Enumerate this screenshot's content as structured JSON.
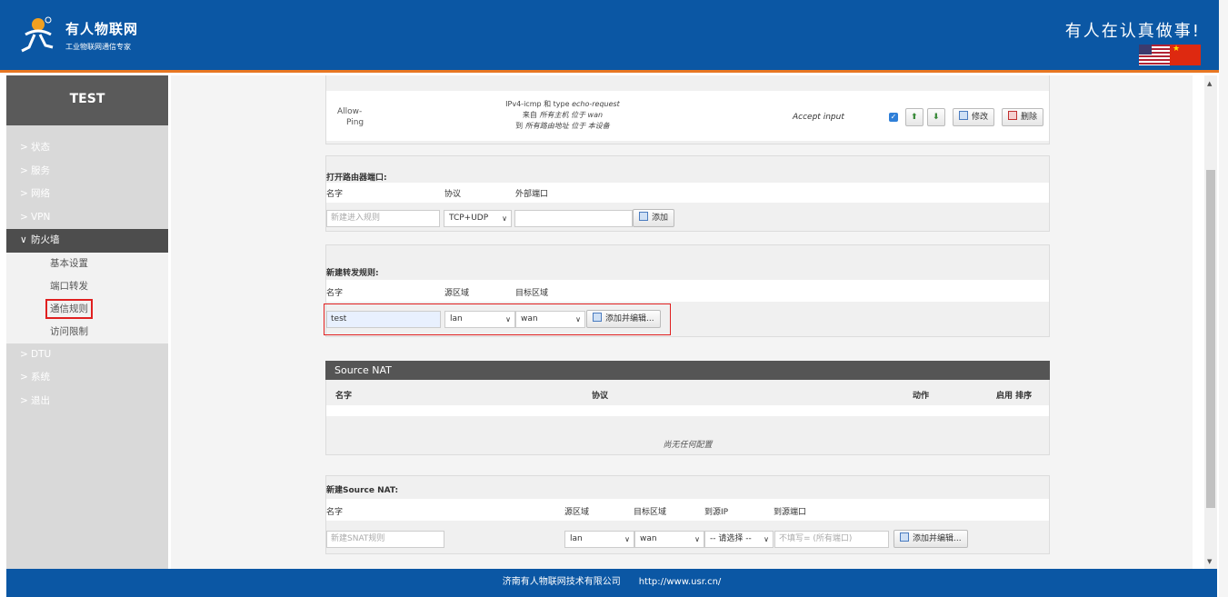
{
  "header": {
    "logo_title": "有人物联网",
    "logo_subtitle": "工业物联网通信专家",
    "slogan": "有人在认真做事!",
    "flag_us_icon": "flag-us-icon",
    "flag_cn_icon": "flag-cn-icon"
  },
  "sidebar": {
    "title": "TEST",
    "items": [
      {
        "label": "状态",
        "chevron": ">"
      },
      {
        "label": "服务",
        "chevron": ">"
      },
      {
        "label": "网络",
        "chevron": ">"
      },
      {
        "label": "VPN",
        "chevron": ">"
      },
      {
        "label": "防火墙",
        "chevron": "∨"
      },
      {
        "label": "DTU",
        "chevron": ">"
      },
      {
        "label": "系统",
        "chevron": ">"
      },
      {
        "label": "退出",
        "chevron": ">"
      }
    ],
    "submenu": [
      "基本设置",
      "端口转发",
      "通信规则",
      "访问限制"
    ]
  },
  "rule": {
    "name_line1": "Allow-",
    "name_line2": "Ping",
    "desc_line1_a": "IPv4-icmp 和 type ",
    "desc_line1_b": "echo-request",
    "desc_line2_a": "来自 ",
    "desc_line2_b": "所有主机 位于 wan",
    "desc_line3_a": "到 ",
    "desc_line3_b": "所有路由地址 位于 本设备",
    "action": "Accept input",
    "enabled_mark": "✓",
    "up_btn": "⬆",
    "down_btn": "⬇",
    "edit_btn": "修改",
    "delete_btn": "删除"
  },
  "open_port": {
    "title": "打开路由器端口:",
    "col_name": "名字",
    "col_protocol": "协议",
    "col_ext_port": "外部端口",
    "name_placeholder": "新建进入规则",
    "protocol_value": "TCP+UDP",
    "add_btn": "添加"
  },
  "new_forward": {
    "title": "新建转发规则:",
    "col_name": "名字",
    "col_src_zone": "源区域",
    "col_dst_zone": "目标区域",
    "name_value": "test",
    "src_value": "lan",
    "dst_value": "wan",
    "add_edit_btn": "添加并编辑..."
  },
  "source_nat": {
    "title": "Source NAT",
    "col_name": "名字",
    "col_protocol": "协议",
    "col_action": "动作",
    "col_enable_sort": "启用  排序",
    "empty_text": "尚无任何配置"
  },
  "new_snat": {
    "title": "新建Source NAT:",
    "col_name": "名字",
    "col_src_zone": "源区域",
    "col_dst_zone": "目标区域",
    "col_to_src_ip": "到源IP",
    "col_to_src_port": "到源端口",
    "name_placeholder": "新建SNAT规则",
    "src_value": "lan",
    "dst_value": "wan",
    "ip_value": "-- 请选择 --",
    "port_placeholder": "不填写= (所有端口)",
    "add_edit_btn": "添加并编辑..."
  },
  "footer": {
    "company": "济南有人物联网技术有限公司",
    "url": "http://www.usr.cn/"
  }
}
